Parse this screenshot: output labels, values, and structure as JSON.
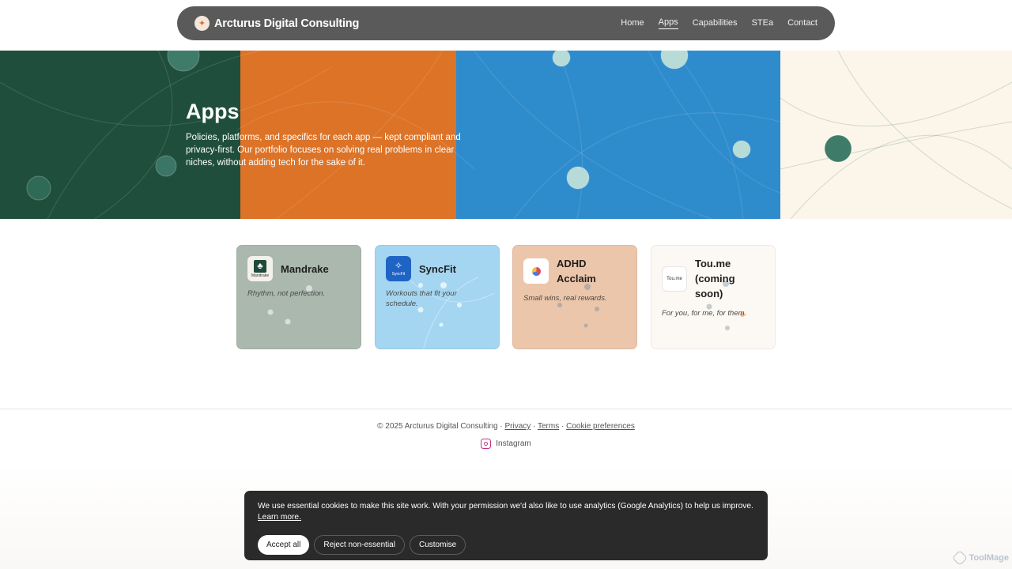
{
  "header": {
    "brand": "Arcturus Digital Consulting",
    "nav": [
      {
        "label": "Home",
        "active": false
      },
      {
        "label": "Apps",
        "active": true
      },
      {
        "label": "Capabilities",
        "active": false
      },
      {
        "label": "STEa",
        "active": false
      },
      {
        "label": "Contact",
        "active": false
      }
    ]
  },
  "hero": {
    "title": "Apps",
    "description": "Policies, platforms, and specifics for each app — kept compliant and privacy-first. Our portfolio focuses on solving real problems in clear niches, without adding tech for the sake of it.",
    "band_colors": [
      "#1f4f3c",
      "#dc7327",
      "#2f8ccc",
      "#fcf5e9"
    ]
  },
  "apps": [
    {
      "name": "Mandrake",
      "tagline": "Rhythm, not perfection.",
      "icon": "mandrake-icon",
      "icon_text": "Mandrake",
      "color": "#aab8ae"
    },
    {
      "name": "SyncFit",
      "tagline": "Workouts that fit your schedule.",
      "icon": "syncfit-icon",
      "icon_text": "SyncFit",
      "color": "#a5d6f1"
    },
    {
      "name": "ADHD Acclaim",
      "tagline": "Small wins, real rewards.",
      "icon": "adhd-acclaim-icon",
      "color": "#ecc6aa"
    },
    {
      "name": "Tou.me (coming soon)",
      "tagline": "For you, for me, for them.",
      "icon": "toume-icon",
      "icon_text": "Tou.me",
      "color": "#fcf8f3"
    }
  ],
  "footer": {
    "copyright": "© 2025 Arcturus Digital Consulting",
    "sep": " · ",
    "privacy": "Privacy",
    "terms": "Terms",
    "cookie_prefs": "Cookie preferences",
    "instagram": "Instagram"
  },
  "cookie_banner": {
    "text": "We use essential cookies to make this site work. With your permission we'd also like to use analytics (Google Analytics) to help us improve.",
    "learn_more": "Learn more.",
    "accept": "Accept all",
    "reject": "Reject non-essential",
    "customise": "Customise"
  },
  "watermark": "ToolMage"
}
